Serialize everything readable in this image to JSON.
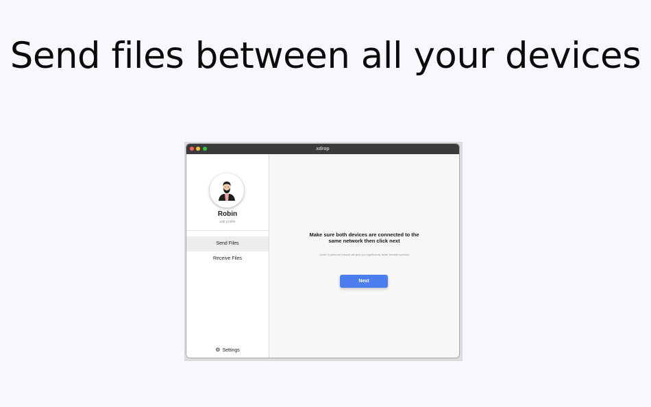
{
  "headline": "Send files between all your devices",
  "window": {
    "title": "xdrop"
  },
  "sidebar": {
    "profile": {
      "name": "Robin",
      "edit_label": "edit profile"
    },
    "items": [
      {
        "label": "Send Files",
        "active": true
      },
      {
        "label": "Receive Files",
        "active": false
      }
    ],
    "settings": {
      "icon": "gear-icon",
      "label": "Settings"
    }
  },
  "main": {
    "instruction": "Make sure both devices are connected to the same network then click next",
    "note": "(Note: A personal hotspot will give you significantly faster transfer speeds)",
    "next_label": "Next"
  },
  "colors": {
    "page_background": "#f6f8fb",
    "title_bar": "#3a3a3a",
    "accent_button": "#4c7ef0",
    "close": "#fe5f57",
    "minimize": "#febc2e",
    "maximize": "#28c840"
  }
}
